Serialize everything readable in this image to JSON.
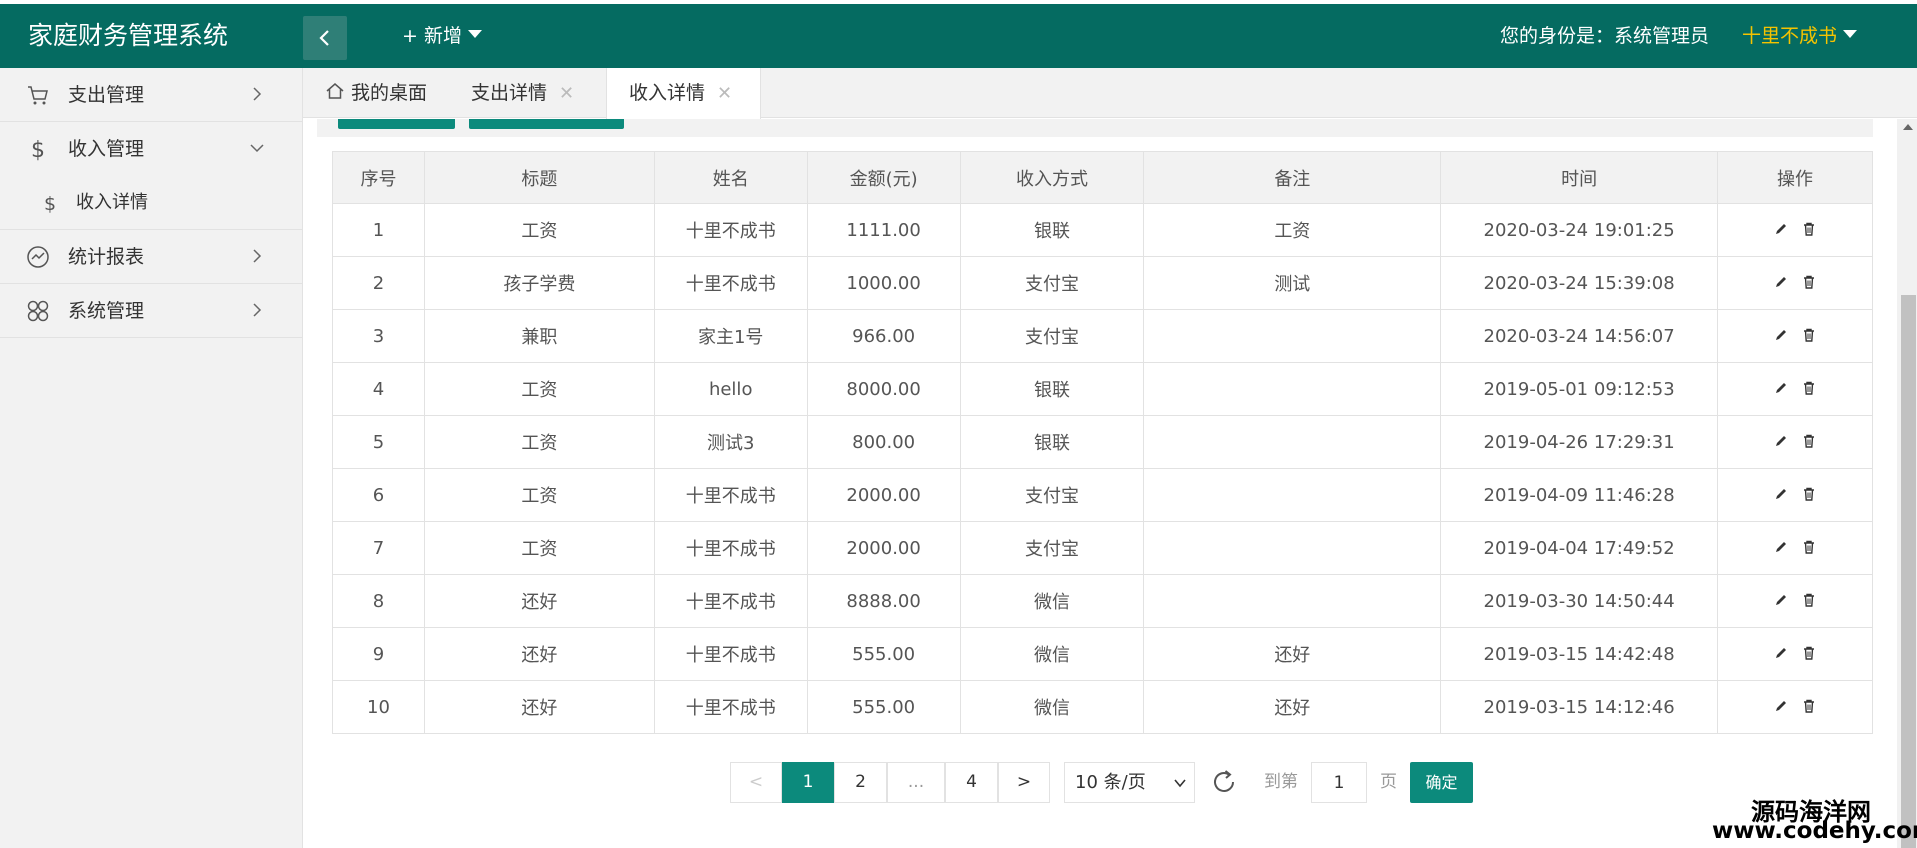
{
  "header": {
    "logo": "家庭财务管理系统",
    "add_menu": "+ 新增",
    "identity": "您的身份是：系统管理员",
    "user": "十里不成书"
  },
  "sidebar": {
    "items": [
      {
        "label": "支出管理",
        "icon": "cart-icon"
      },
      {
        "label": "收入管理",
        "icon": "dollar-icon"
      },
      {
        "label": "收入详情",
        "icon": "dollar-icon"
      },
      {
        "label": "统计报表",
        "icon": "chart-icon"
      },
      {
        "label": "系统管理",
        "icon": "clover-icon"
      }
    ]
  },
  "tabs": [
    {
      "label": "我的桌面"
    },
    {
      "label": "支出详情"
    },
    {
      "label": "收入详情"
    }
  ],
  "table": {
    "headers": [
      "序号",
      "标题",
      "姓名",
      "金额(元)",
      "收入方式",
      "备注",
      "时间",
      "操作"
    ],
    "rows": [
      [
        "1",
        "工资",
        "十里不成书",
        "1111.00",
        "银联",
        "工资",
        "2020-03-24 19:01:25"
      ],
      [
        "2",
        "孩子学费",
        "十里不成书",
        "1000.00",
        "支付宝",
        "测试",
        "2020-03-24 15:39:08"
      ],
      [
        "3",
        "兼职",
        "家主1号",
        "966.00",
        "支付宝",
        "",
        "2020-03-24 14:56:07"
      ],
      [
        "4",
        "工资",
        "hello",
        "8000.00",
        "银联",
        "",
        "2019-05-01 09:12:53"
      ],
      [
        "5",
        "工资",
        "测试3",
        "800.00",
        "银联",
        "",
        "2019-04-26 17:29:31"
      ],
      [
        "6",
        "工资",
        "十里不成书",
        "2000.00",
        "支付宝",
        "",
        "2019-04-09 11:46:28"
      ],
      [
        "7",
        "工资",
        "十里不成书",
        "2000.00",
        "支付宝",
        "",
        "2019-04-04 17:49:52"
      ],
      [
        "8",
        "还好",
        "十里不成书",
        "8888.00",
        "微信",
        "",
        "2019-03-30 14:50:44"
      ],
      [
        "9",
        "还好",
        "十里不成书",
        "555.00",
        "微信",
        "还好",
        "2019-03-15 14:42:48"
      ],
      [
        "10",
        "还好",
        "十里不成书",
        "555.00",
        "微信",
        "还好",
        "2019-03-15 14:12:46"
      ]
    ]
  },
  "pagination": {
    "prev": "<",
    "pages": [
      "1",
      "2",
      "...",
      "4"
    ],
    "current": "1",
    "next": ">",
    "page_size": "10 条/页",
    "goto_label": "到第",
    "goto_value": "1",
    "page_label": "页",
    "confirm": "确定"
  },
  "watermark": {
    "line1": "源码海洋网",
    "line2": "www.codehy.com"
  },
  "colors": {
    "header_bg": "#056b61",
    "accent": "#0c8a7c",
    "user_name": "#f5c300"
  }
}
